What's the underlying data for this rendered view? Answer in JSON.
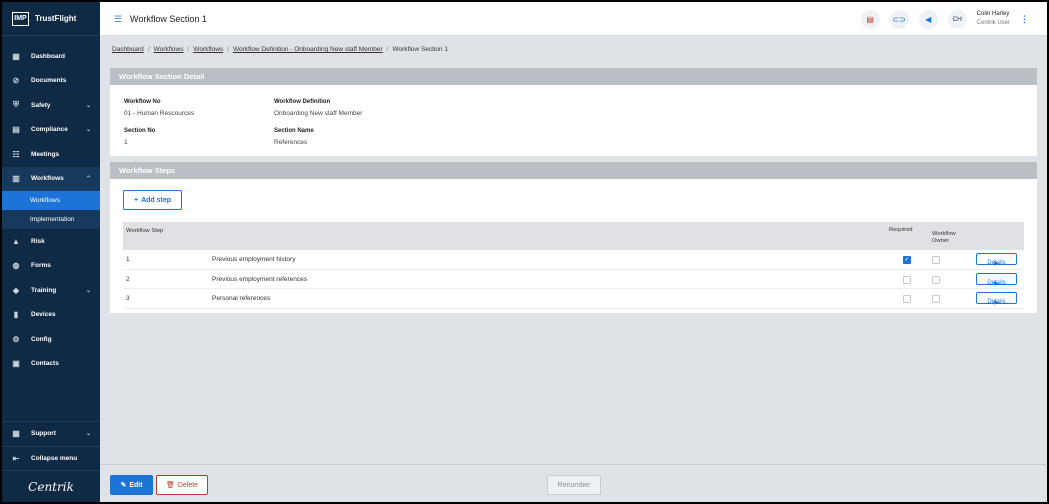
{
  "brand": {
    "logo": "IMP",
    "name": "TrustFlight"
  },
  "sidebar": {
    "items": [
      {
        "label": "Dashboard",
        "icon": "dashboard-icon"
      },
      {
        "label": "Documents",
        "icon": "paperclip-icon"
      },
      {
        "label": "Safety",
        "icon": "shield-icon"
      },
      {
        "label": "Compliance",
        "icon": "clipboard-icon"
      },
      {
        "label": "Meetings",
        "icon": "people-icon"
      },
      {
        "label": "Workflows",
        "icon": "workflow-icon"
      },
      {
        "label": "Risk",
        "icon": "warning-icon"
      },
      {
        "label": "Forms",
        "icon": "forms-icon"
      },
      {
        "label": "Training",
        "icon": "graduation-cap-icon"
      },
      {
        "label": "Devices",
        "icon": "device-icon"
      },
      {
        "label": "Config",
        "icon": "wrench-icon"
      },
      {
        "label": "Contacts",
        "icon": "contacts-icon"
      }
    ],
    "workflow_sub": [
      "Workflows",
      "Implementation"
    ],
    "support": "Support",
    "collapse": "Collapse menu",
    "footer_logo": "Centrik"
  },
  "topbar": {
    "title": "Workflow Section 1",
    "user_initials": "CH",
    "user_name": "Colin Harley",
    "user_role": "Centrik User"
  },
  "breadcrumb": [
    "Dashboard",
    "Workflows",
    "Workflows",
    "Workflow Definition - Onboarding New staff Member",
    "Workflow Section 1"
  ],
  "detail": {
    "heading": "Workflow Section Detail",
    "workflow_no_label": "Workflow No",
    "workflow_no": "01 - Human Rescources",
    "definition_label": "Workflow Definition",
    "definition": "Onboarding New staff Member",
    "section_no_label": "Section No",
    "section_no": "1",
    "section_name_label": "Section Name",
    "section_name": "References"
  },
  "steps": {
    "heading": "Workflow Steps",
    "add_label": "Add step",
    "columns": {
      "step": "Workflow Step",
      "required": "Required",
      "owner_line1": "Workflow",
      "owner_line2": "Owner"
    },
    "details_label": "Details",
    "rows": [
      {
        "no": "1",
        "name": "Previous employment history",
        "required": true,
        "owner": false
      },
      {
        "no": "2",
        "name": "Previous employment references",
        "required": false,
        "owner": false
      },
      {
        "no": "3",
        "name": "Personal references",
        "required": false,
        "owner": false
      }
    ]
  },
  "footer": {
    "edit": "Edit",
    "delete": "Delete",
    "renumber": "Renumber"
  },
  "colors": {
    "sidebar": "#0f2a44",
    "accent": "#1e73d6",
    "danger": "#c0392b",
    "panel_head": "#b9bfc5"
  }
}
